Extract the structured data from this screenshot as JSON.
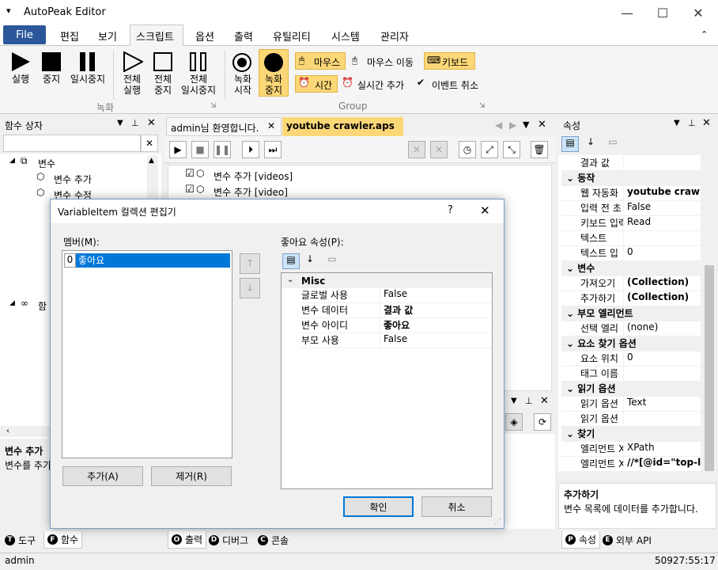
{
  "window": {
    "title": "AutoPeak Editor"
  },
  "menu": {
    "file": "File",
    "items": [
      "편집",
      "보기",
      "스크립트",
      "옵션",
      "출력",
      "유틸리티",
      "시스템",
      "관리자"
    ]
  },
  "ribbon": {
    "run": "실행",
    "stop": "중지",
    "pause": "일시중지",
    "run_all": "전체\n실행",
    "stop_all": "전체\n중지",
    "pause_all": "전체\n일시중지",
    "rec_start": "녹화\n시작",
    "rec_stop": "녹화\n중지",
    "mouse": "마우스",
    "mouse_move": "마우스 이동",
    "keyboard": "키보드",
    "time": "시간",
    "realtime_add": "실시간 추가",
    "event_cancel": "이벤트 취소",
    "group_record": "녹화",
    "group_group": "Group"
  },
  "toolbox": {
    "title": "함수 상자",
    "tree": [
      "변수",
      "변수 추가",
      "변수 수정",
      "함"
    ],
    "desc_title": "변수 추가",
    "desc_text": "변수를 추가",
    "tabs": [
      "도구",
      "함수"
    ]
  },
  "doc": {
    "tabs": [
      "admin님 환영합니다.",
      "youtube crawler.aps"
    ],
    "lines": [
      "변수 추가 [videos]",
      "변수 추가 [video]"
    ],
    "bottom_tabs": [
      "출력",
      "디버그",
      "콘솔"
    ]
  },
  "props": {
    "title": "속성",
    "rows": [
      {
        "k": "결과 값",
        "v": "",
        "cat": false
      },
      {
        "k": "동작",
        "v": "",
        "cat": true
      },
      {
        "k": "웹 자동화",
        "v": "youtube crawler",
        "cat": false,
        "bold": true
      },
      {
        "k": "입력 전 초",
        "v": "False",
        "cat": false
      },
      {
        "k": "키보드 입력",
        "v": "Read",
        "cat": false
      },
      {
        "k": "텍스트",
        "v": "",
        "cat": false
      },
      {
        "k": "텍스트 입",
        "v": "0",
        "cat": false
      },
      {
        "k": "변수",
        "v": "",
        "cat": true
      },
      {
        "k": "가져오기",
        "v": "(Collection)",
        "cat": false,
        "bold": true
      },
      {
        "k": "추가하기",
        "v": "(Collection)",
        "cat": false,
        "bold": true
      },
      {
        "k": "부모 엘리먼트",
        "v": "",
        "cat": true
      },
      {
        "k": "선택 엘리",
        "v": "(none)",
        "cat": false
      },
      {
        "k": "요소 찾기 옵션",
        "v": "",
        "cat": true
      },
      {
        "k": "요소 위치",
        "v": "0",
        "cat": false
      },
      {
        "k": "태그 이름",
        "v": "",
        "cat": false
      },
      {
        "k": "읽기 옵션",
        "v": "",
        "cat": true
      },
      {
        "k": "읽기 옵션",
        "v": "Text",
        "cat": false
      },
      {
        "k": "읽기 옵션",
        "v": "",
        "cat": false
      },
      {
        "k": "찾기",
        "v": "",
        "cat": true
      },
      {
        "k": "엘리먼트 X",
        "v": "XPath",
        "cat": false
      },
      {
        "k": "엘리먼트 X",
        "v": "//*[@id=\"top-lev",
        "cat": false,
        "bold": true
      }
    ],
    "desc_title": "추가하기",
    "desc_text": "변수 목록에 데이터를 추가합니다.",
    "tabs": [
      "속성",
      "외부 API"
    ]
  },
  "dialog": {
    "title": "VariableItem 컬렉션 편집기",
    "help": "?",
    "members_label": "멤버(M):",
    "member_index": "0",
    "member_name": "좋아요",
    "props_label": "좋아요 속성(P):",
    "category": "Misc",
    "rows": [
      {
        "k": "글로벌 사용",
        "v": "False",
        "bold": false
      },
      {
        "k": "변수 데이터",
        "v": "결과 값",
        "bold": true
      },
      {
        "k": "변수 아이디",
        "v": "좋아요",
        "bold": true
      },
      {
        "k": "부모 사용",
        "v": "False",
        "bold": false
      }
    ],
    "add": "추가(A)",
    "remove": "제거(R)",
    "ok": "확인",
    "cancel": "취소"
  },
  "status": {
    "user": "admin",
    "time": "50927:55:17"
  }
}
